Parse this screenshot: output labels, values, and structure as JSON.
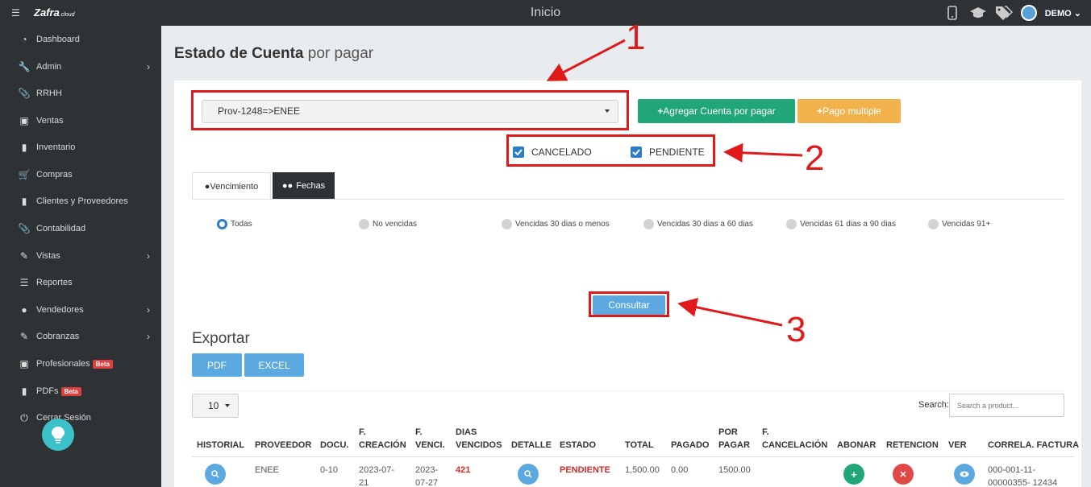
{
  "topbar": {
    "logo": "Zafra",
    "logo_suffix": ".cloud",
    "title": "Inicio",
    "user": "DEMO"
  },
  "sidebar": {
    "items": [
      {
        "label": "Dashboard",
        "icon": "dashboard-icon",
        "chevron": false
      },
      {
        "label": "Admin",
        "icon": "wrench-icon",
        "chevron": true
      },
      {
        "label": "RRHH",
        "icon": "paperclip-icon",
        "chevron": false
      },
      {
        "label": "Ventas",
        "icon": "money-icon",
        "chevron": false
      },
      {
        "label": "Inventario",
        "icon": "book-icon",
        "chevron": false
      },
      {
        "label": "Compras",
        "icon": "cart-icon",
        "chevron": false
      },
      {
        "label": "Clientes y Proveedores",
        "icon": "book-icon",
        "chevron": false
      },
      {
        "label": "Contabilidad",
        "icon": "paperclip-icon",
        "chevron": false
      },
      {
        "label": "Vistas",
        "icon": "edit-icon",
        "chevron": true
      },
      {
        "label": "Reportes",
        "icon": "list-icon",
        "chevron": false
      },
      {
        "label": "Vendedores",
        "icon": "user-icon",
        "chevron": true
      },
      {
        "label": "Cobranzas",
        "icon": "edit-icon",
        "chevron": true
      },
      {
        "label": "Profesionales",
        "icon": "money-icon",
        "chevron": false,
        "badge": "Beta"
      },
      {
        "label": "PDFs",
        "icon": "book-icon",
        "chevron": false,
        "badge": "Beta"
      },
      {
        "label": "Cerrar Sesión",
        "icon": "power-icon",
        "chevron": false
      }
    ]
  },
  "page": {
    "title_bold": "Estado de Cuenta",
    "title_rest": "por pagar"
  },
  "provider_select": {
    "value": "Prov-1248=>ENEE"
  },
  "buttons": {
    "add_account": "Agregar Cuenta por pagar",
    "multi_payment": "Pago multiple",
    "consultar": "Consultar",
    "pdf": "PDF",
    "excel": "EXCEL"
  },
  "filters": {
    "cancelado": "CANCELADO",
    "pendiente": "PENDIENTE"
  },
  "tabs": [
    "Vencimiento",
    "Fechas"
  ],
  "radios": [
    {
      "label": "Todas",
      "checked": true
    },
    {
      "label": "No vencidas",
      "checked": false
    },
    {
      "label": "Vencidas 30 dias o menos",
      "checked": false
    },
    {
      "label": "Vencidas 30 dias a 60 dias",
      "checked": false
    },
    {
      "label": "Vencidas 61 dias a 90 dias",
      "checked": false
    },
    {
      "label": "Vencidas 91+",
      "checked": false
    }
  ],
  "export_title": "Exportar",
  "table": {
    "page_size": "10",
    "search_label": "Search:",
    "search_placeholder": "Search a product...",
    "headers": [
      [
        "HISTORIAL"
      ],
      [
        "PROVEEDOR"
      ],
      [
        "DOCU."
      ],
      [
        "F.",
        "CREACIÓN"
      ],
      [
        "F.",
        "VENCI."
      ],
      [
        "DIAS",
        "VENCIDOS"
      ],
      [
        "DETALLE"
      ],
      [
        "ESTADO"
      ],
      [
        "TOTAL"
      ],
      [
        "PAGADO"
      ],
      [
        "POR",
        "PAGAR"
      ],
      [
        "F.",
        "CANCELACIÓN"
      ],
      [
        "ABONAR"
      ],
      [
        "RETENCION"
      ],
      [
        "VER"
      ],
      [
        "CORRELA. FACTURA"
      ]
    ],
    "row": {
      "proveedor": "ENEE",
      "docu": "0-10",
      "f_creacion": [
        "2023-07-",
        "21"
      ],
      "f_venci": [
        "2023-",
        "07-27"
      ],
      "dias_vencidos": "421",
      "estado": "PENDIENTE",
      "total": "1,500.00",
      "pagado": "0.00",
      "por_pagar": "1500.00",
      "correla": [
        "000-001-11-",
        "00000355- 12434"
      ]
    }
  },
  "annotations": [
    "1",
    "2",
    "3"
  ],
  "colors": {
    "sidebar": "#2f3235",
    "green": "#21a67a",
    "orange": "#f1b24c",
    "blue": "#5ba9e0",
    "annotation_red": "#e01a1a"
  }
}
